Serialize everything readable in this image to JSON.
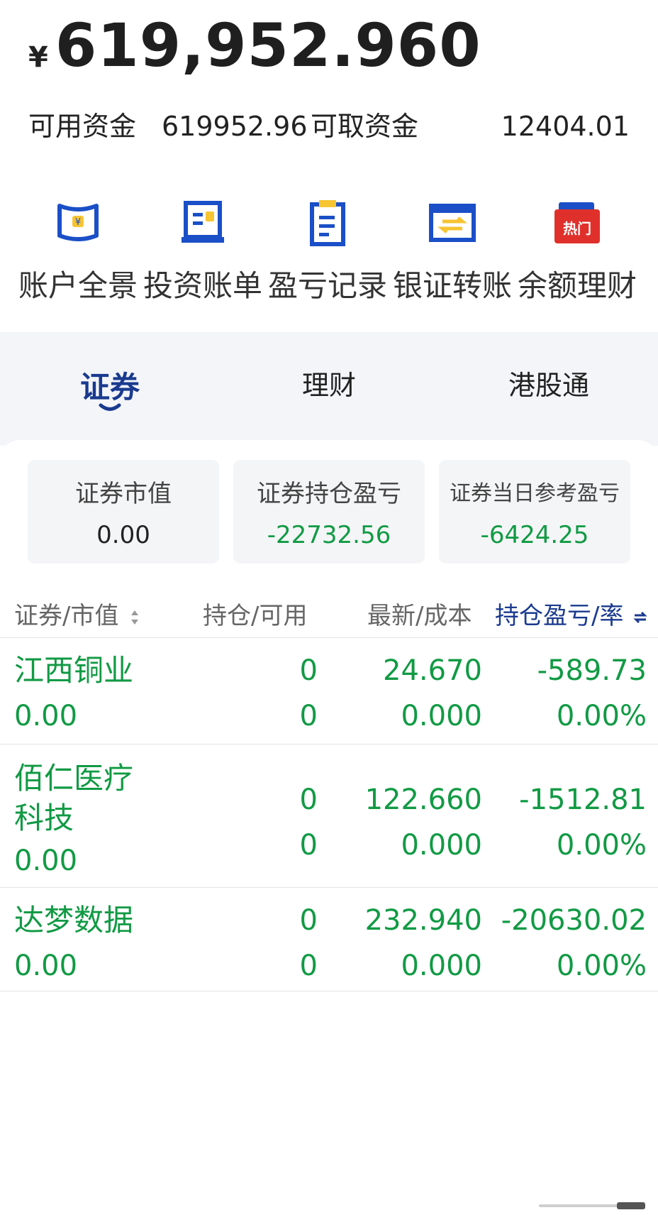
{
  "balance": {
    "symbol": "¥",
    "amount": "619,952.960"
  },
  "funds": {
    "available_label": "可用资金",
    "available_value": "619952.96",
    "withdrawable_label": "可取资金",
    "withdrawable_value": "12404.01"
  },
  "quick_actions": [
    {
      "label": "账户全景",
      "icon": "scroll-yuan-icon"
    },
    {
      "label": "投资账单",
      "icon": "bill-icon"
    },
    {
      "label": "盈亏记录",
      "icon": "record-icon"
    },
    {
      "label": "银证转账",
      "icon": "transfer-icon"
    },
    {
      "label": "余额理财",
      "icon": "wallet-icon",
      "badge": "热门"
    }
  ],
  "tabs": [
    {
      "label": "证券",
      "active": true
    },
    {
      "label": "理财",
      "active": false
    },
    {
      "label": "港股通",
      "active": false
    }
  ],
  "stats": [
    {
      "label": "证券市值",
      "value": "0.00"
    },
    {
      "label": "证券持仓盈亏",
      "value": "-22732.56"
    },
    {
      "label": "证券当日参考盈亏",
      "value": "-6424.25"
    }
  ],
  "table": {
    "headers": [
      "证券/市值",
      "持仓/可用",
      "最新/成本",
      "持仓盈亏/率"
    ],
    "rows": [
      {
        "name": "江西铜业",
        "market_value": "0.00",
        "position": "0",
        "available": "0",
        "latest": "24.670",
        "cost": "0.000",
        "pnl": "-589.73",
        "pnl_rate": "0.00%"
      },
      {
        "name": "佰仁医疗科技",
        "market_value": "0.00",
        "position": "0",
        "available": "0",
        "latest": "122.660",
        "cost": "0.000",
        "pnl": "-1512.81",
        "pnl_rate": "0.00%"
      },
      {
        "name": "达梦数据",
        "market_value": "0.00",
        "position": "0",
        "available": "0",
        "latest": "232.940",
        "cost": "0.000",
        "pnl": "-20630.02",
        "pnl_rate": "0.00%"
      }
    ]
  },
  "colors": {
    "accent": "#1a3a8f",
    "gain_green": "#119a44",
    "panel_grey": "#f3f5f9",
    "icon_blue": "#1a4fc7",
    "icon_yellow": "#f7c531",
    "hot_red": "#e0302b"
  }
}
